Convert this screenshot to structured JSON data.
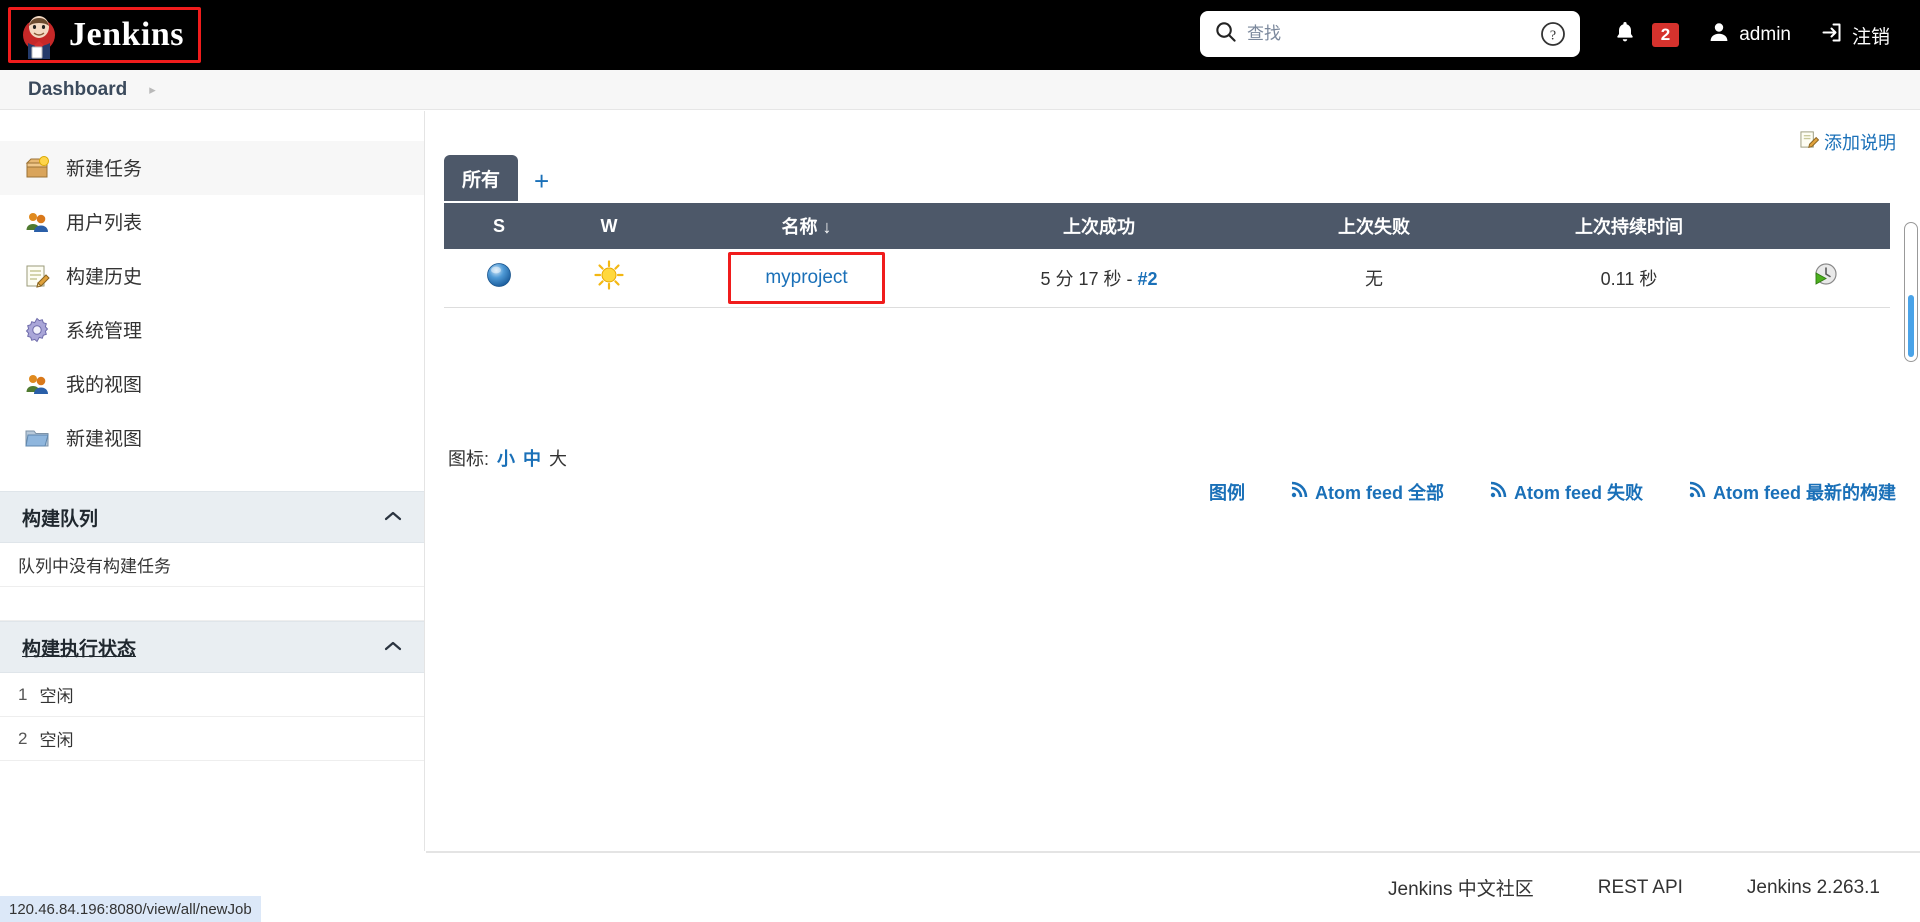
{
  "header": {
    "brand": "Jenkins",
    "logo_icon": "jenkins-butler-logo",
    "search": {
      "placeholder": "查找",
      "value": "",
      "icon": "search-icon"
    },
    "help_icon": "question-circle-icon",
    "notifications": {
      "icon": "bell-icon",
      "count": "2"
    },
    "user": {
      "icon": "person-icon",
      "name": "admin"
    },
    "logout": {
      "icon": "logout-icon",
      "label": "注销"
    }
  },
  "breadcrumb": {
    "items": [
      "Dashboard"
    ],
    "chevron": "▸"
  },
  "sidebar": {
    "items": [
      {
        "label": "新建任务",
        "icon": "new-job-box-icon",
        "active": true
      },
      {
        "label": "用户列表",
        "icon": "people-icon",
        "active": false
      },
      {
        "label": "构建历史",
        "icon": "notepad-pencil-icon",
        "active": false
      },
      {
        "label": "系统管理",
        "icon": "gear-icon",
        "active": false
      },
      {
        "label": "我的视图",
        "icon": "people-icon",
        "active": false
      },
      {
        "label": "新建视图",
        "icon": "folder-icon",
        "active": false
      }
    ],
    "build_queue": {
      "title": "构建队列",
      "collapse_icon": "chevron-up-icon",
      "empty_text": "队列中没有构建任务"
    },
    "build_executor": {
      "title": "构建执行状态",
      "collapse_icon": "chevron-up-icon",
      "executors": [
        {
          "num": "1",
          "status": "空闲"
        },
        {
          "num": "2",
          "status": "空闲"
        }
      ]
    }
  },
  "main": {
    "add_description": {
      "label": "添加说明",
      "icon": "edit-note-icon"
    },
    "tabs": [
      {
        "label": "所有",
        "active": true
      }
    ],
    "add_tab_label": "+",
    "table": {
      "columns": [
        "S",
        "W",
        "名称  ↓",
        "上次成功",
        "上次失败",
        "上次持续时间",
        ""
      ],
      "rows": [
        {
          "status_icon": "blue-ball-success-icon",
          "weather_icon": "sunny-weather-icon",
          "name": "myproject",
          "highlighted": true,
          "last_success": "5 分 17 秒 - ",
          "last_success_build": "#2",
          "last_failure": "无",
          "last_duration": "0.11 秒",
          "action_icon": "schedule-build-icon"
        }
      ]
    },
    "icon_legend": {
      "label": "图标:",
      "sizes": [
        {
          "label": "小",
          "current": false
        },
        {
          "label": "中",
          "current": false
        },
        {
          "label": "大",
          "current": true
        }
      ]
    },
    "bottom_links": [
      {
        "label": "图例",
        "icon": ""
      },
      {
        "label": "Atom feed 全部",
        "icon": "rss-icon"
      },
      {
        "label": "Atom feed 失败",
        "icon": "rss-icon"
      },
      {
        "label": "Atom feed 最新的构建",
        "icon": "rss-icon"
      }
    ]
  },
  "footer": {
    "community": "Jenkins 中文社区",
    "rest_api": "REST API",
    "version": "Jenkins 2.263.1"
  },
  "statusbar": {
    "url": "120.46.84.196:8080/view/all/newJob"
  }
}
